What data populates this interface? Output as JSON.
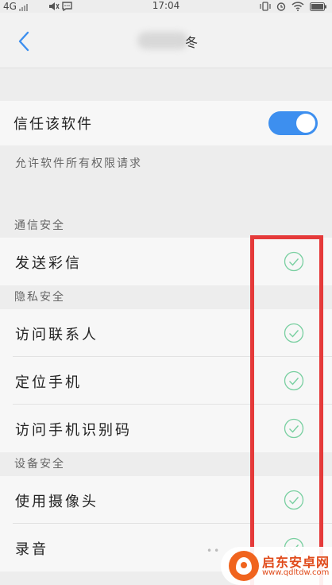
{
  "status_bar": {
    "network": "4G",
    "time": "17:04"
  },
  "nav": {
    "title_glyph": "冬"
  },
  "trust": {
    "label": "信任该软件",
    "enabled": true,
    "description": "允许软件所有权限请求"
  },
  "sections": [
    {
      "header": "通信安全",
      "items": [
        {
          "label": "发送彩信",
          "allowed": true
        }
      ]
    },
    {
      "header": "隐私安全",
      "items": [
        {
          "label": "访问联系人",
          "allowed": true
        },
        {
          "label": "定位手机",
          "allowed": true
        },
        {
          "label": "访问手机识别码",
          "allowed": true
        }
      ]
    },
    {
      "header": "设备安全",
      "items": [
        {
          "label": "使用摄像头",
          "allowed": true
        },
        {
          "label": "录音",
          "allowed": true
        }
      ]
    }
  ],
  "watermark": {
    "name": "启东安卓网",
    "url": "www.qdltdw.com"
  },
  "colors": {
    "toggle_on": "#3d8fef",
    "check": "#78cfa0",
    "highlight": "#e53a3a",
    "watermark": "#f0641e"
  }
}
